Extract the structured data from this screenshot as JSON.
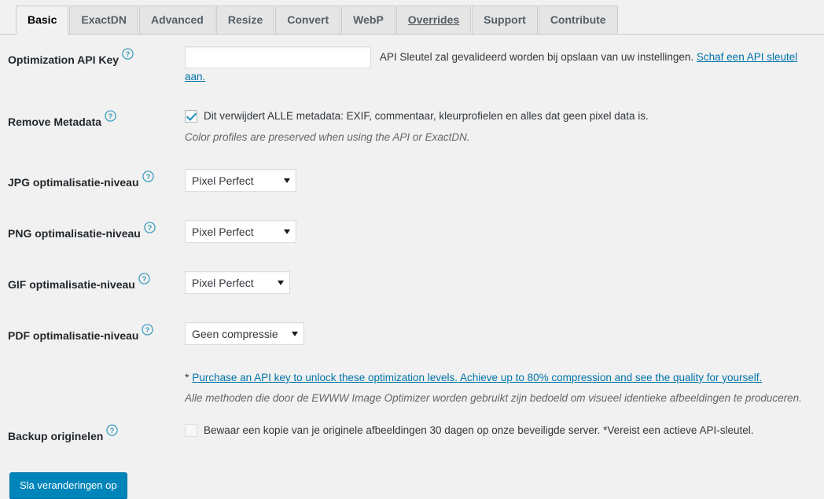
{
  "tabs": [
    {
      "label": "Basic",
      "active": true,
      "underlined": false
    },
    {
      "label": "ExactDN",
      "active": false,
      "underlined": false
    },
    {
      "label": "Advanced",
      "active": false,
      "underlined": false
    },
    {
      "label": "Resize",
      "active": false,
      "underlined": false
    },
    {
      "label": "Convert",
      "active": false,
      "underlined": false
    },
    {
      "label": "WebP",
      "active": false,
      "underlined": false
    },
    {
      "label": "Overrides",
      "active": false,
      "underlined": true
    },
    {
      "label": "Support",
      "active": false,
      "underlined": false
    },
    {
      "label": "Contribute",
      "active": false,
      "underlined": false
    }
  ],
  "rows": {
    "api_key": {
      "label": "Optimization API Key",
      "input_value": "",
      "note_text": "API Sleutel zal gevalideerd worden bij opslaan van uw instellingen.",
      "note_link": "Schaf een API sleutel aan."
    },
    "remove_metadata": {
      "label": "Remove Metadata",
      "checkbox_label": "Dit verwijdert ALLE metadata: EXIF, commentaar, kleurprofielen en alles dat geen pixel data is.",
      "checked": true,
      "description": "Color profiles are preserved when using the API or ExactDN."
    },
    "jpg_level": {
      "label": "JPG optimalisatie-niveau",
      "value": "Pixel Perfect"
    },
    "png_level": {
      "label": "PNG optimalisatie-niveau",
      "value": "Pixel Perfect"
    },
    "gif_level": {
      "label": "GIF optimalisatie-niveau",
      "value": "Pixel Perfect"
    },
    "pdf_level": {
      "label": "PDF optimalisatie-niveau",
      "value": "Geen compressie"
    },
    "purchase": {
      "star": "*",
      "link": "Purchase an API key to unlock these optimization levels. Achieve up to 80% compression and see the quality for yourself.",
      "description": "Alle methoden die door de EWWW Image Optimizer worden gebruikt zijn bedoeld om visueel identieke afbeeldingen te produceren."
    },
    "backup": {
      "label": "Backup originelen",
      "checkbox_label": "Bewaar een kopie van je originele afbeeldingen 30 dagen op onze beveiligde server. *Vereist een actieve API-sleutel.",
      "checked": false
    }
  },
  "submit": {
    "label": "Sla veranderingen op"
  },
  "icons": {
    "help": "help-circle-question-icon",
    "chevron": "chevron-down-icon"
  },
  "colors": {
    "accent": "#0073aa",
    "button": "#0085ba",
    "help_icon": "#1e8cbe",
    "page_bg": "#f1f1f1"
  }
}
